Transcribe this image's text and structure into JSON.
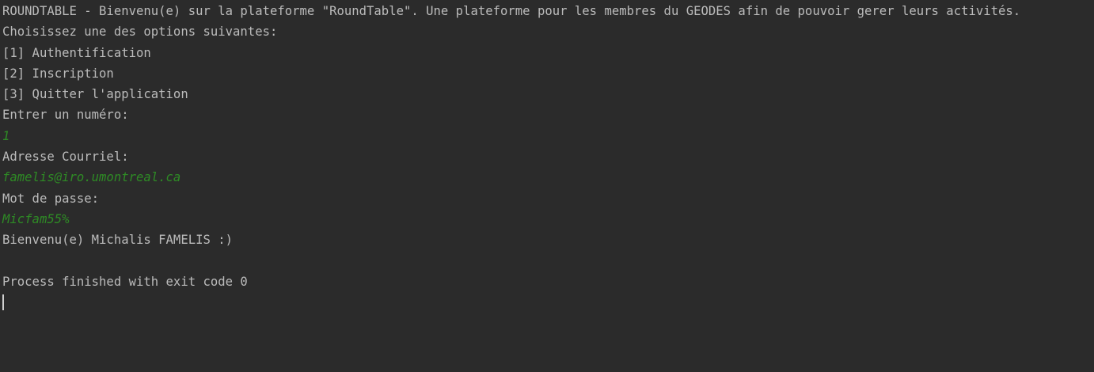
{
  "console": {
    "header": "ROUNDTABLE - Bienvenu(e) sur la plateforme \"RoundTable\". Une plateforme pour les membres du GEODES afin de pouvoir gerer leurs activités.",
    "choose_prompt": "Choisissez une des options suivantes:",
    "options": [
      "[1] Authentification",
      "[2] Inscription",
      "[3] Quitter l'application"
    ],
    "number_prompt": "Entrer un numéro:",
    "number_input": "1",
    "email_prompt": "Adresse Courriel:",
    "email_input": "famelis@iro.umontreal.ca",
    "password_prompt": "Mot de passe:",
    "password_input": "Micfam55%",
    "welcome": "Bienvenu(e) Michalis FAMELIS :)",
    "exit_message": "Process finished with exit code 0"
  },
  "colors": {
    "background": "#2b2b2b",
    "output_text": "#bbbbbb",
    "user_input": "#2e8b25"
  }
}
